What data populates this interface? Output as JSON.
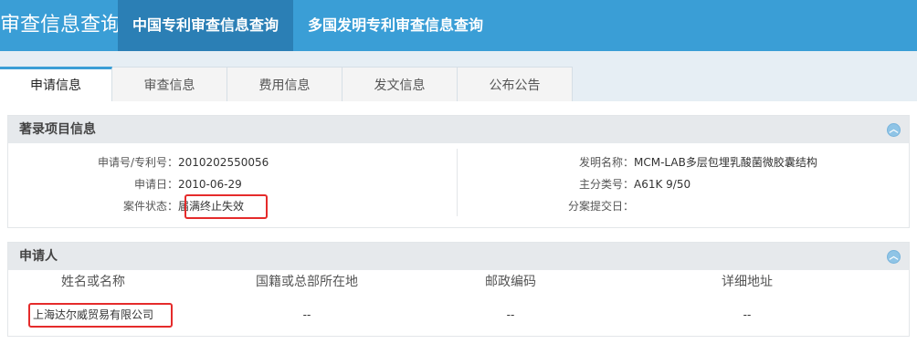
{
  "header": {
    "brand": "审查信息查询",
    "nav": [
      {
        "label": "中国专利审查信息查询",
        "active": true
      },
      {
        "label": "多国发明专利审查信息查询",
        "active": false
      }
    ]
  },
  "tabs": [
    {
      "label": "申请信息",
      "active": true
    },
    {
      "label": "审查信息",
      "active": false
    },
    {
      "label": "费用信息",
      "active": false
    },
    {
      "label": "发文信息",
      "active": false
    },
    {
      "label": "公布公告",
      "active": false
    }
  ],
  "biblio": {
    "title": "著录项目信息",
    "fields_left": [
      {
        "label": "申请号/专利号：",
        "value": "2010202550056"
      },
      {
        "label": "申请日：",
        "value": "2010-06-29"
      },
      {
        "label": "案件状态：",
        "value": "届满终止失效"
      }
    ],
    "fields_right": [
      {
        "label": "发明名称：",
        "value": "MCM-LAB多层包埋乳酸菌微胶囊结构"
      },
      {
        "label": "主分类号：",
        "value": "A61K 9/50"
      },
      {
        "label": "分案提交日：",
        "value": ""
      }
    ]
  },
  "applicant": {
    "title": "申请人",
    "columns": [
      "姓名或名称",
      "国籍或总部所在地",
      "邮政编码",
      "详细地址"
    ],
    "rows": [
      [
        "上海达尔威贸易有限公司",
        "--",
        "--",
        "--"
      ]
    ]
  },
  "colors": {
    "header_bg": "#3a9ed6",
    "active_nav_bg": "#2b7fb5",
    "highlight_border": "#e52b2b"
  },
  "icons": {
    "collapse": "chevron-up-icon"
  }
}
